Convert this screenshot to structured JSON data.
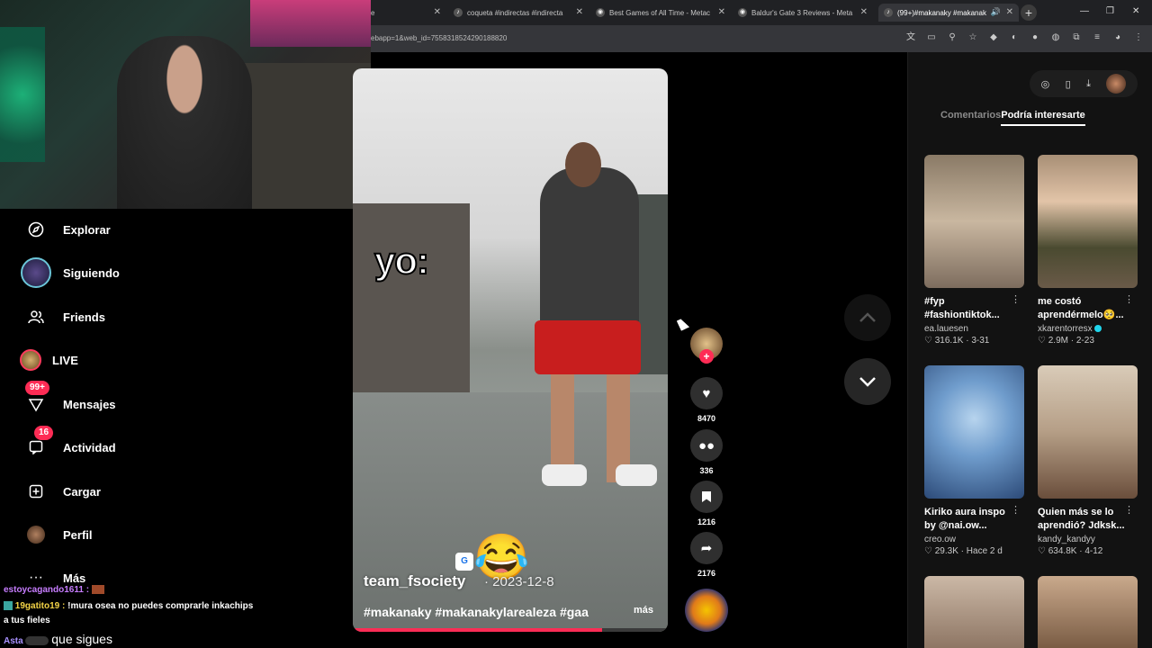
{
  "browser": {
    "tabs": [
      {
        "title": "e"
      },
      {
        "title": "coqueta #indirectas #indirecta"
      },
      {
        "title": "Best Games of All Time - Metac"
      },
      {
        "title": "Baldur's Gate 3 Reviews - Meta"
      },
      {
        "title": "(99+)#makanaky #makanak"
      }
    ],
    "address_fragment": "ebapp=1&web_id=7558318524290188820"
  },
  "sidebar": {
    "items": [
      {
        "label": "Explorar",
        "icon": "compass-icon"
      },
      {
        "label": "Siguiendo",
        "icon": "avatar"
      },
      {
        "label": "Friends",
        "icon": "friends-icon"
      },
      {
        "label": "LIVE",
        "icon": "live-avatar"
      },
      {
        "label": "Mensajes",
        "icon": "messages-icon",
        "badge": "99+"
      },
      {
        "label": "Actividad",
        "icon": "activity-icon",
        "badge": "16"
      },
      {
        "label": "Cargar",
        "icon": "upload-icon"
      },
      {
        "label": "Perfil",
        "icon": "profile-avatar"
      },
      {
        "label": "Más",
        "icon": "more-icon"
      }
    ]
  },
  "chat": {
    "lines": [
      {
        "user": "estoycagando1611 :",
        "text": ""
      },
      {
        "user": "19gatito19 :",
        "text": "!mura osea no puedes comprarle inkachips"
      },
      {
        "user": "",
        "text": "a tus fieles"
      },
      {
        "user": "Asta",
        "text": "que sigues"
      }
    ]
  },
  "video": {
    "overlay_text": "yo:",
    "author": "team_fsociety",
    "date": "· 2023-12-8",
    "hashtags": "#makanaky #makanakylarealeza #gaa",
    "more_label": "más",
    "progress": 0.79
  },
  "actions": {
    "likes": "8470",
    "comments": "336",
    "saves": "1216",
    "shares": "2176"
  },
  "right_panel": {
    "tabs": [
      {
        "label": "Comentarios",
        "active": false
      },
      {
        "label": "Podría interesarte",
        "active": true
      }
    ],
    "cards": [
      {
        "title": "#fyp #fashiontiktok...",
        "author": "ea.lauesen",
        "likes": "316.1K",
        "age": "3-31",
        "verified": false
      },
      {
        "title": "me costó aprendérmelo🥺...",
        "author": "xkarentorresx",
        "likes": "2.9M",
        "age": "2-23",
        "verified": true
      },
      {
        "title": "Kiriko aura inspo by @nai.ow...",
        "author": "creo.ow",
        "likes": "29.3K",
        "age": "Hace 2 d",
        "verified": false
      },
      {
        "title": "Quien más se lo aprendió? Jdksk...",
        "author": "kandy_kandyy",
        "likes": "634.8K",
        "age": "4-12",
        "verified": false
      }
    ]
  },
  "colors": {
    "accent": "#fe2c55",
    "verified": "#20d5ec",
    "background": "#000000",
    "panel": "#121212"
  }
}
